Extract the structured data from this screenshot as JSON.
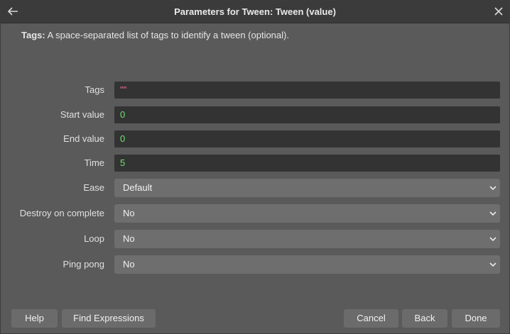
{
  "window": {
    "title": "Parameters for Tween: Tween (value)"
  },
  "description": {
    "bold_label": "Tags:",
    "text": " A space-separated list of tags to identify a tween (optional)."
  },
  "fields": {
    "tags": {
      "label": "Tags",
      "value": "\"\""
    },
    "start_value": {
      "label": "Start value",
      "value": "0"
    },
    "end_value": {
      "label": "End value",
      "value": "0"
    },
    "time": {
      "label": "Time",
      "value": "5"
    },
    "ease": {
      "label": "Ease",
      "value": "Default"
    },
    "destroy_on_complete": {
      "label": "Destroy on complete",
      "value": "No"
    },
    "loop": {
      "label": "Loop",
      "value": "No"
    },
    "ping_pong": {
      "label": "Ping pong",
      "value": "No"
    }
  },
  "buttons": {
    "help": "Help",
    "find_expressions": "Find Expressions",
    "cancel": "Cancel",
    "back": "Back",
    "done": "Done"
  },
  "icons": {
    "back": "arrow-left-icon",
    "close": "close-icon",
    "dropdown": "chevron-down-icon"
  },
  "colors": {
    "string_value": "#e8709a",
    "number_value": "#6fe06f"
  }
}
